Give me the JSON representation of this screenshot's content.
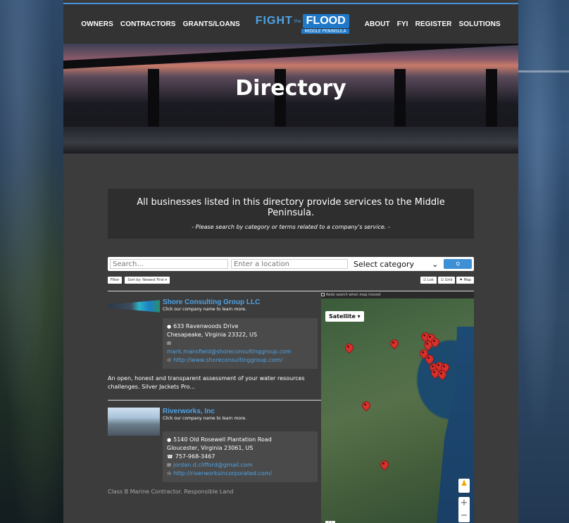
{
  "nav": {
    "left": [
      "OWNERS",
      "CONTRACTORS",
      "GRANTS/LOANS"
    ],
    "right": [
      "ABOUT",
      "FYI",
      "REGISTER",
      "SOLUTIONS"
    ],
    "logo": {
      "fight": "FIGHT",
      "the": "the",
      "flood": "FLOOD",
      "sub": "MIDDLE PENINSULA"
    }
  },
  "hero": {
    "title": "Directory"
  },
  "intro": {
    "main": "All businesses listed in this directory provide services to the Middle Peninsula.",
    "sub": "- Please search by category or terms related to a company's service. -"
  },
  "search": {
    "search_placeholder": "Search...",
    "location_placeholder": "Enter a location",
    "category_value": "Select category",
    "go_label": "Q"
  },
  "tools": {
    "filter": "Filter",
    "sort": "Sort by: Newest First ▾",
    "view_list": "☷ List",
    "view_grid": "☷ Grid",
    "view_map": "⚑ Map"
  },
  "map": {
    "redo_label": "Redo search when map moved",
    "satellite_label": "Satellite ▾",
    "pegman": "♟",
    "zoom_in": "+",
    "zoom_out": "−",
    "fullscreen": "[ ]"
  },
  "listings": [
    {
      "name": "Shore Consulting Group LLC",
      "click_hint": "Click our company name to learn more.",
      "address1": "633 Ravenwoods Drive",
      "address2": "Chesapeake, Virginia 23322, US",
      "phone": "",
      "email": "mark.mansfield@shoreconsultinggroup.com",
      "website": "http://www.shoreconsultinggroup.com/",
      "description": "An open, honest and transparent assessment of your water resources challenges. Silver Jackets Pro..."
    },
    {
      "name": "Riverworks, Inc",
      "click_hint": "Click our company name to learn more.",
      "address1": "5140 Old Rosewell Plantation Road",
      "address2": "Gloucester, Virginia 23061, US",
      "phone": "757-968-3467",
      "email": "jordan.d.clifford@gmail.com",
      "website": "http://riverworksincorporated.com/",
      "description": "Class B Marine Contractor. Responsible Land"
    }
  ]
}
